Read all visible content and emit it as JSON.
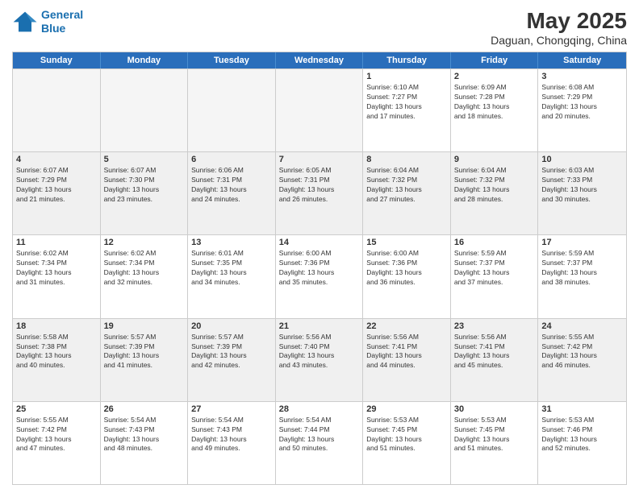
{
  "logo": {
    "line1": "General",
    "line2": "Blue"
  },
  "title": {
    "month_year": "May 2025",
    "location": "Daguan, Chongqing, China"
  },
  "day_headers": [
    "Sunday",
    "Monday",
    "Tuesday",
    "Wednesday",
    "Thursday",
    "Friday",
    "Saturday"
  ],
  "weeks": [
    [
      {
        "num": "",
        "info": "",
        "empty": true
      },
      {
        "num": "",
        "info": "",
        "empty": true
      },
      {
        "num": "",
        "info": "",
        "empty": true
      },
      {
        "num": "",
        "info": "",
        "empty": true
      },
      {
        "num": "1",
        "info": "Sunrise: 6:10 AM\nSunset: 7:27 PM\nDaylight: 13 hours\nand 17 minutes."
      },
      {
        "num": "2",
        "info": "Sunrise: 6:09 AM\nSunset: 7:28 PM\nDaylight: 13 hours\nand 18 minutes."
      },
      {
        "num": "3",
        "info": "Sunrise: 6:08 AM\nSunset: 7:29 PM\nDaylight: 13 hours\nand 20 minutes."
      }
    ],
    [
      {
        "num": "4",
        "info": "Sunrise: 6:07 AM\nSunset: 7:29 PM\nDaylight: 13 hours\nand 21 minutes."
      },
      {
        "num": "5",
        "info": "Sunrise: 6:07 AM\nSunset: 7:30 PM\nDaylight: 13 hours\nand 23 minutes."
      },
      {
        "num": "6",
        "info": "Sunrise: 6:06 AM\nSunset: 7:31 PM\nDaylight: 13 hours\nand 24 minutes."
      },
      {
        "num": "7",
        "info": "Sunrise: 6:05 AM\nSunset: 7:31 PM\nDaylight: 13 hours\nand 26 minutes."
      },
      {
        "num": "8",
        "info": "Sunrise: 6:04 AM\nSunset: 7:32 PM\nDaylight: 13 hours\nand 27 minutes."
      },
      {
        "num": "9",
        "info": "Sunrise: 6:04 AM\nSunset: 7:32 PM\nDaylight: 13 hours\nand 28 minutes."
      },
      {
        "num": "10",
        "info": "Sunrise: 6:03 AM\nSunset: 7:33 PM\nDaylight: 13 hours\nand 30 minutes."
      }
    ],
    [
      {
        "num": "11",
        "info": "Sunrise: 6:02 AM\nSunset: 7:34 PM\nDaylight: 13 hours\nand 31 minutes."
      },
      {
        "num": "12",
        "info": "Sunrise: 6:02 AM\nSunset: 7:34 PM\nDaylight: 13 hours\nand 32 minutes."
      },
      {
        "num": "13",
        "info": "Sunrise: 6:01 AM\nSunset: 7:35 PM\nDaylight: 13 hours\nand 34 minutes."
      },
      {
        "num": "14",
        "info": "Sunrise: 6:00 AM\nSunset: 7:36 PM\nDaylight: 13 hours\nand 35 minutes."
      },
      {
        "num": "15",
        "info": "Sunrise: 6:00 AM\nSunset: 7:36 PM\nDaylight: 13 hours\nand 36 minutes."
      },
      {
        "num": "16",
        "info": "Sunrise: 5:59 AM\nSunset: 7:37 PM\nDaylight: 13 hours\nand 37 minutes."
      },
      {
        "num": "17",
        "info": "Sunrise: 5:59 AM\nSunset: 7:37 PM\nDaylight: 13 hours\nand 38 minutes."
      }
    ],
    [
      {
        "num": "18",
        "info": "Sunrise: 5:58 AM\nSunset: 7:38 PM\nDaylight: 13 hours\nand 40 minutes."
      },
      {
        "num": "19",
        "info": "Sunrise: 5:57 AM\nSunset: 7:39 PM\nDaylight: 13 hours\nand 41 minutes."
      },
      {
        "num": "20",
        "info": "Sunrise: 5:57 AM\nSunset: 7:39 PM\nDaylight: 13 hours\nand 42 minutes."
      },
      {
        "num": "21",
        "info": "Sunrise: 5:56 AM\nSunset: 7:40 PM\nDaylight: 13 hours\nand 43 minutes."
      },
      {
        "num": "22",
        "info": "Sunrise: 5:56 AM\nSunset: 7:41 PM\nDaylight: 13 hours\nand 44 minutes."
      },
      {
        "num": "23",
        "info": "Sunrise: 5:56 AM\nSunset: 7:41 PM\nDaylight: 13 hours\nand 45 minutes."
      },
      {
        "num": "24",
        "info": "Sunrise: 5:55 AM\nSunset: 7:42 PM\nDaylight: 13 hours\nand 46 minutes."
      }
    ],
    [
      {
        "num": "25",
        "info": "Sunrise: 5:55 AM\nSunset: 7:42 PM\nDaylight: 13 hours\nand 47 minutes."
      },
      {
        "num": "26",
        "info": "Sunrise: 5:54 AM\nSunset: 7:43 PM\nDaylight: 13 hours\nand 48 minutes."
      },
      {
        "num": "27",
        "info": "Sunrise: 5:54 AM\nSunset: 7:43 PM\nDaylight: 13 hours\nand 49 minutes."
      },
      {
        "num": "28",
        "info": "Sunrise: 5:54 AM\nSunset: 7:44 PM\nDaylight: 13 hours\nand 50 minutes."
      },
      {
        "num": "29",
        "info": "Sunrise: 5:53 AM\nSunset: 7:45 PM\nDaylight: 13 hours\nand 51 minutes."
      },
      {
        "num": "30",
        "info": "Sunrise: 5:53 AM\nSunset: 7:45 PM\nDaylight: 13 hours\nand 51 minutes."
      },
      {
        "num": "31",
        "info": "Sunrise: 5:53 AM\nSunset: 7:46 PM\nDaylight: 13 hours\nand 52 minutes."
      }
    ]
  ]
}
